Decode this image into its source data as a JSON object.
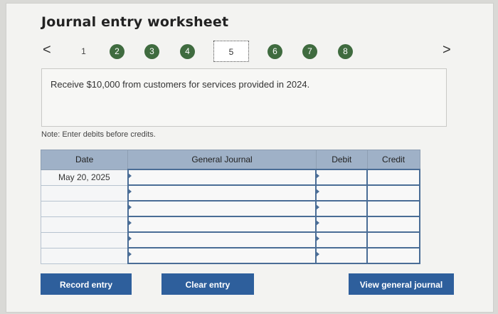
{
  "title": "Journal entry worksheet",
  "nav": {
    "prev": "<",
    "next": ">"
  },
  "steps": [
    "1",
    "2",
    "3",
    "4",
    "5",
    "6",
    "7",
    "8"
  ],
  "current_step": "5",
  "description": "Receive $10,000 from customers for services provided in 2024.",
  "note": "Note: Enter debits before credits.",
  "table": {
    "headers": {
      "date": "Date",
      "journal": "General Journal",
      "debit": "Debit",
      "credit": "Credit"
    },
    "rows": [
      {
        "date": "May 20, 2025"
      },
      {
        "date": ""
      },
      {
        "date": ""
      },
      {
        "date": ""
      },
      {
        "date": ""
      },
      {
        "date": ""
      }
    ]
  },
  "buttons": {
    "record": "Record entry",
    "clear": "Clear entry",
    "view": "View general journal"
  },
  "colors": {
    "accent": "#2e5f9c",
    "step_done": "#3f6b3f",
    "header": "#9fb1c7"
  }
}
